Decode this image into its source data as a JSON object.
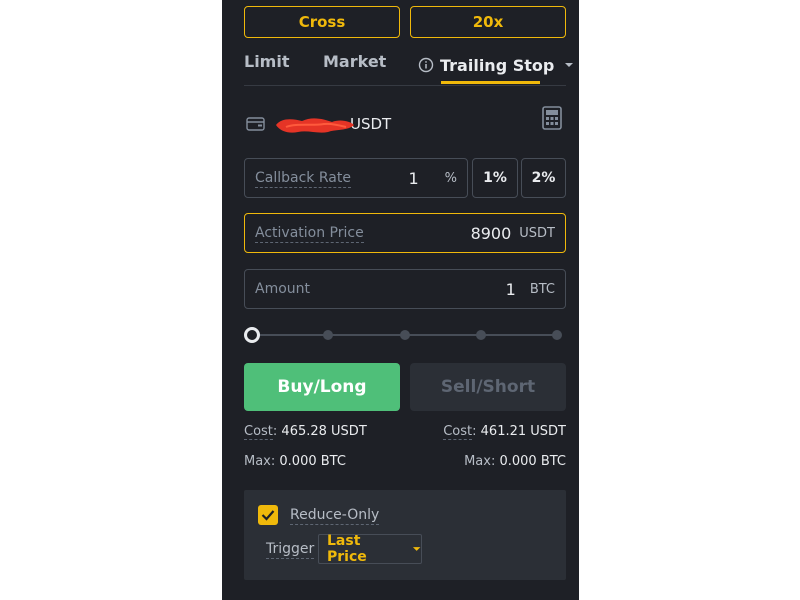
{
  "margin_mode": {
    "mode_label": "Cross",
    "leverage_label": "20x"
  },
  "tabs": [
    {
      "label": "Limit"
    },
    {
      "label": "Market"
    },
    {
      "label": "Trailing Stop"
    }
  ],
  "balance": {
    "unit": "USDT"
  },
  "callback_rate": {
    "label": "Callback Rate",
    "value": "1",
    "unit": "%"
  },
  "quick_rates": [
    "1%",
    "2%"
  ],
  "activation_price": {
    "label": "Activation Price",
    "value": "8900",
    "unit": "USDT"
  },
  "amount": {
    "label": "Amount",
    "value": "1",
    "unit": "BTC"
  },
  "slider": {
    "percent": 0,
    "steps": 5
  },
  "buttons": {
    "buy": "Buy/Long",
    "sell": "Sell/Short"
  },
  "buy_info": {
    "cost_label": "Cost",
    "cost_value": "465.28 USDT",
    "max_label": "Max",
    "max_value": "0.000 BTC"
  },
  "sell_info": {
    "cost_label": "Cost",
    "cost_value": "461.21 USDT",
    "max_label": "Max",
    "max_value": "0.000 BTC"
  },
  "options": {
    "reduce_only_label": "Reduce-Only",
    "reduce_only_checked": true,
    "trigger_label": "Trigger",
    "trigger_value": "Last Price"
  },
  "colors": {
    "accent": "#f0b90b",
    "buy": "#4fbf79",
    "panel": "#1e2026"
  }
}
